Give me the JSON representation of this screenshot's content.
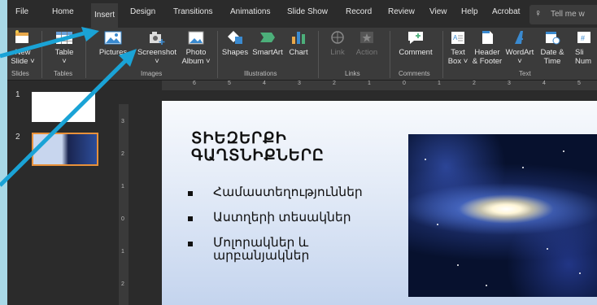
{
  "tabs": [
    "File",
    "Home",
    "Insert",
    "Design",
    "Transitions",
    "Animations",
    "Slide Show",
    "Record",
    "Review",
    "View",
    "Help",
    "Acrobat"
  ],
  "tell_me": "Tell me w",
  "ribbon": {
    "new_slide": "New\nSlide ˅",
    "table": "Table\n˅",
    "pictures": "Pictures",
    "screenshot": "Screenshot\n˅",
    "photo_album": "Photo\nAlbum ˅",
    "shapes": "Shapes",
    "smartart": "SmartArt",
    "chart": "Chart",
    "link": "Link",
    "action": "Action",
    "comment": "Comment",
    "text_box": "Text\nBox ˅",
    "header_footer": "Header\n& Footer",
    "wordart": "WordArt\n˅",
    "date_time": "Date &\nTime",
    "slide_num": "Sli\nNum"
  },
  "groups": {
    "slides": "Slides",
    "tables": "Tables",
    "images": "Images",
    "illustrations": "Illustrations",
    "links": "Links",
    "comments": "Comments",
    "text": "Text"
  },
  "ruler_h": [
    "6",
    "5",
    "4",
    "3",
    "2",
    "1",
    "0",
    "1",
    "2",
    "3",
    "4",
    "5"
  ],
  "ruler_v": [
    "3",
    "2",
    "1",
    "0",
    "1",
    "2"
  ],
  "thumbs": {
    "n1": "1",
    "n2": "2"
  },
  "slide": {
    "title": "ՏԻԵԶԵՐՔԻ\nԳԱՂՏՆԻՔՆԵՐԸ",
    "bullets": [
      "Համաստեղություններ",
      "Աստղերի տեսակներ",
      "Մոլորակներ և\nարբանյակներ"
    ]
  },
  "colors": {
    "arrow": "#1aa3d6",
    "selection": "#e8913a",
    "ribbon_bg": "#3b3b3b"
  }
}
